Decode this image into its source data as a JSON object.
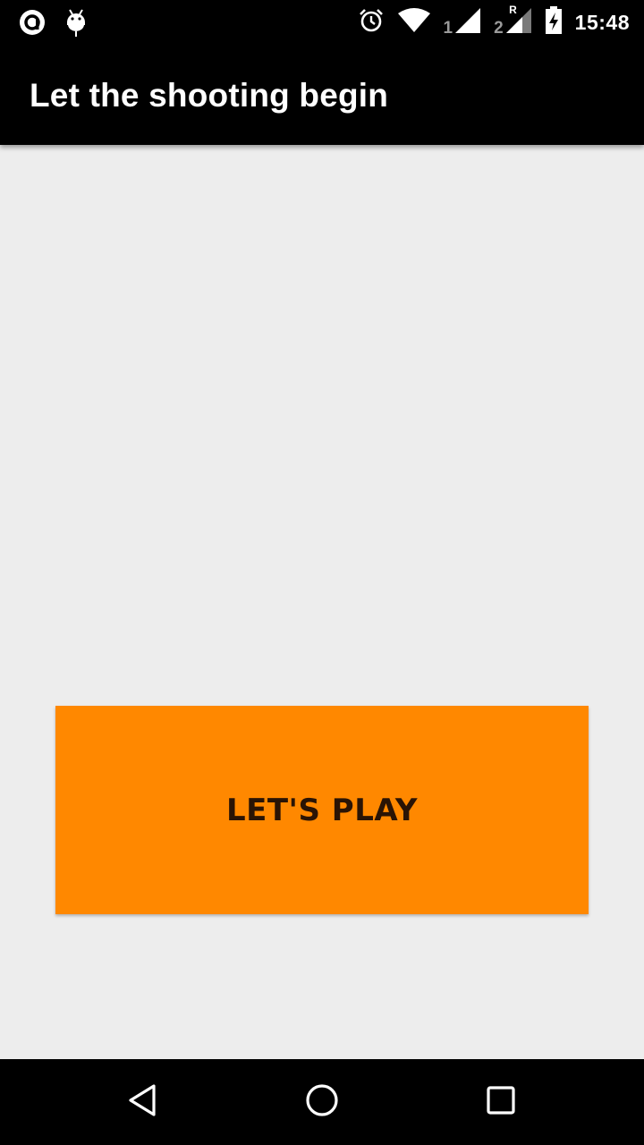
{
  "status_bar": {
    "time": "15:48",
    "sim1_label": "1",
    "sim2_label": "2",
    "roaming_label": "R",
    "icons": [
      "app-notification-icon",
      "android-debug-icon",
      "alarm-icon",
      "wifi-icon",
      "signal-sim1-icon",
      "signal-sim2-icon",
      "battery-charging-icon"
    ]
  },
  "app_bar": {
    "title": "Let the shooting begin"
  },
  "main": {
    "play_button_label": "LET'S PLAY",
    "play_button_color": "#ff8800"
  },
  "nav_bar": {
    "icons": [
      "back-icon",
      "home-icon",
      "recents-icon"
    ]
  }
}
